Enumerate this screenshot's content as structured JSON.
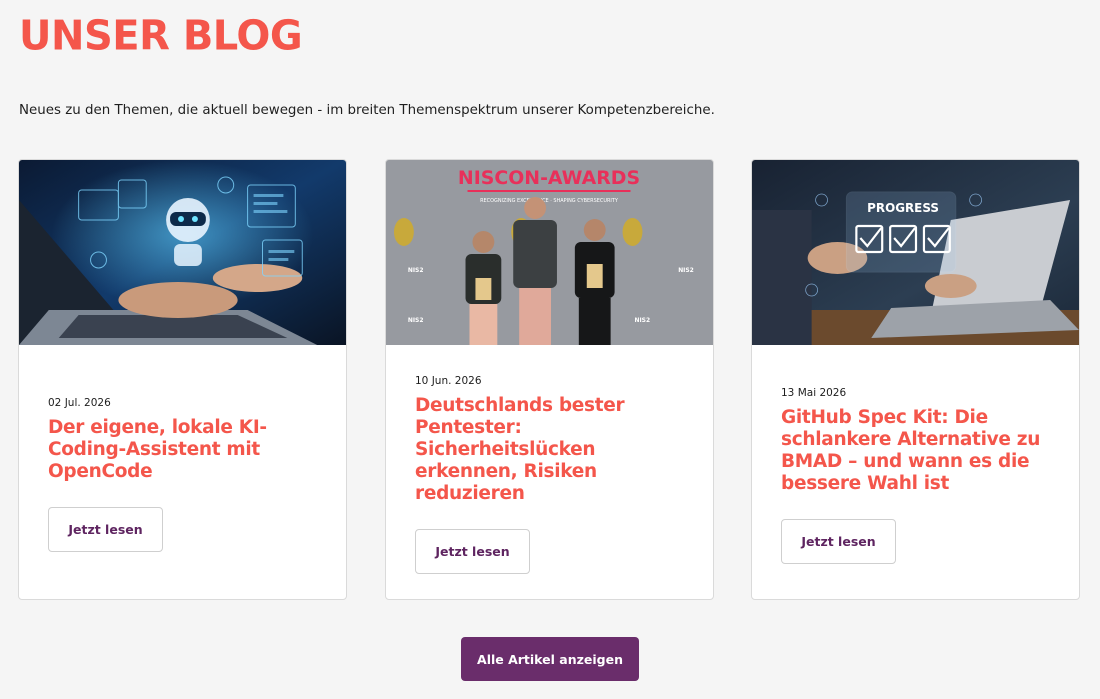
{
  "header": {
    "title": "UNSER BLOG",
    "intro": "Neues zu den Themen, die aktuell bewegen - im breiten Themenspektrum unserer Kompetenzbereiche."
  },
  "colors": {
    "accent": "#f4564b",
    "brand": "#6a2d6b",
    "background": "#f5f5f5"
  },
  "posts": [
    {
      "date": "02 Jul. 2026",
      "title": "Der eigene, lokale KI-Coding-Assistent mit OpenCode",
      "cta": "Jetzt lesen",
      "image": "laptop-ai-robot-hologram"
    },
    {
      "date": "10 Jun. 2026",
      "title": "Deutschlands bester Pentester: Sicherheitslücken erkennen, Risiken reduzieren",
      "cta": "Jetzt lesen",
      "image": "niscon-awards-photo",
      "image_banner": "NISCON-AWARDS",
      "image_subtitle": "RECOGNIZING EXCELLENCE · SHAPING CYBERSECURITY",
      "image_logo": "NIS2"
    },
    {
      "date": "13 Mai 2026",
      "title": "GitHub Spec Kit: Die schlankere Alternative zu BMAD – und wann es die bessere Wahl ist",
      "cta": "Jetzt lesen",
      "image": "laptop-progress-checklist",
      "image_label": "PROGRESS"
    }
  ],
  "footer": {
    "all_articles": "Alle Artikel anzeigen"
  }
}
